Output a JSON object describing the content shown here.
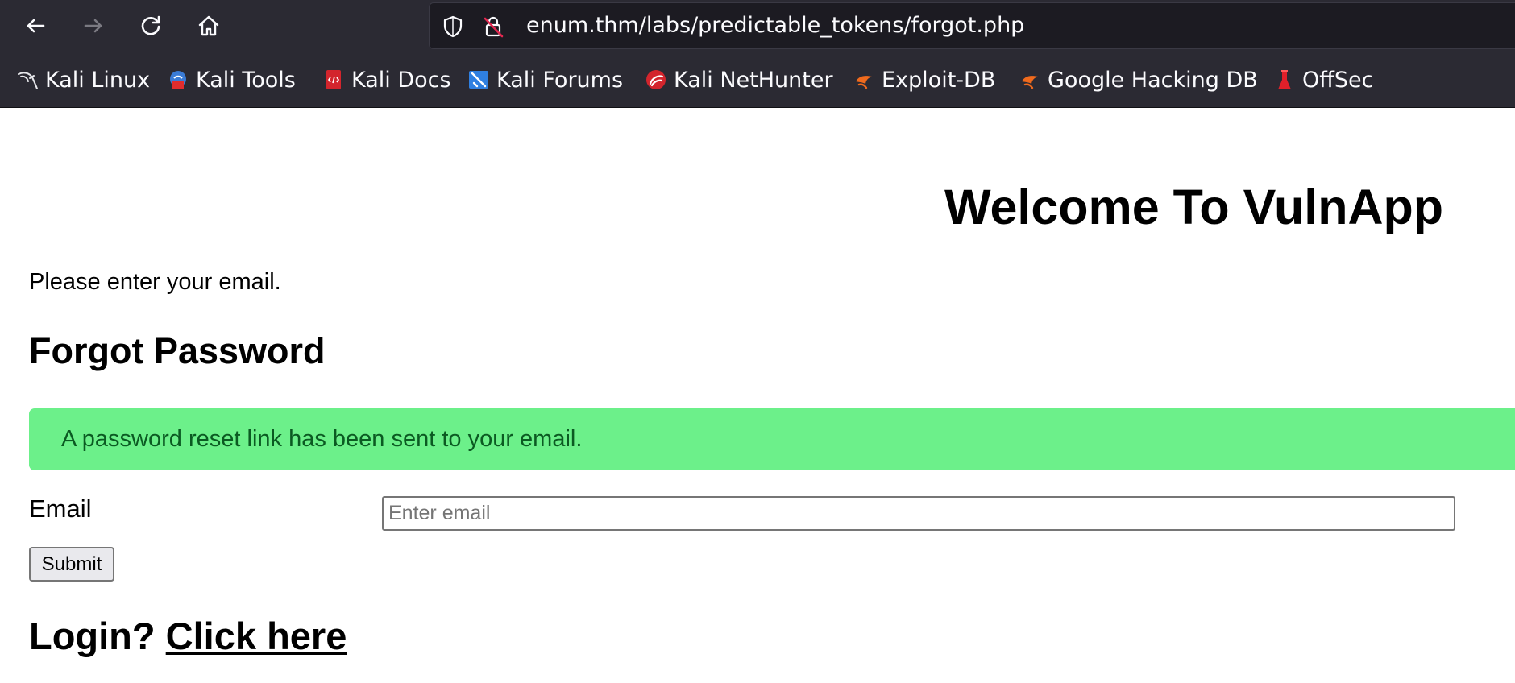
{
  "browser": {
    "url": "enum.thm/labs/predictable_tokens/forgot.php",
    "bookmarks": [
      {
        "label": "Kali Linux",
        "icon": "kali-dragon-icon"
      },
      {
        "label": "Kali Tools",
        "icon": "kali-tools-icon"
      },
      {
        "label": "Kali Docs",
        "icon": "kali-docs-icon"
      },
      {
        "label": "Kali Forums",
        "icon": "kali-forums-icon"
      },
      {
        "label": "Kali NetHunter",
        "icon": "kali-nethunter-icon"
      },
      {
        "label": "Exploit-DB",
        "icon": "exploit-db-icon"
      },
      {
        "label": "Google Hacking DB",
        "icon": "exploit-db-icon"
      },
      {
        "label": "OffSec",
        "icon": "offsec-icon"
      }
    ],
    "colors": {
      "chrome": "#2b2a33",
      "urlbar": "#1c1b22"
    }
  },
  "page": {
    "site_title": "Welcome To VulnApp",
    "intro": "Please enter your email.",
    "form_title": "Forgot Password",
    "alert": "A password reset link has been sent to your email.",
    "email_label": "Email",
    "email_placeholder": "Enter email",
    "email_value": "",
    "submit_label": "Submit",
    "login_prefix": "Login?",
    "login_link": "Click here",
    "colors": {
      "alert_bg": "#6cf08a",
      "alert_text": "#0b5a22"
    }
  }
}
